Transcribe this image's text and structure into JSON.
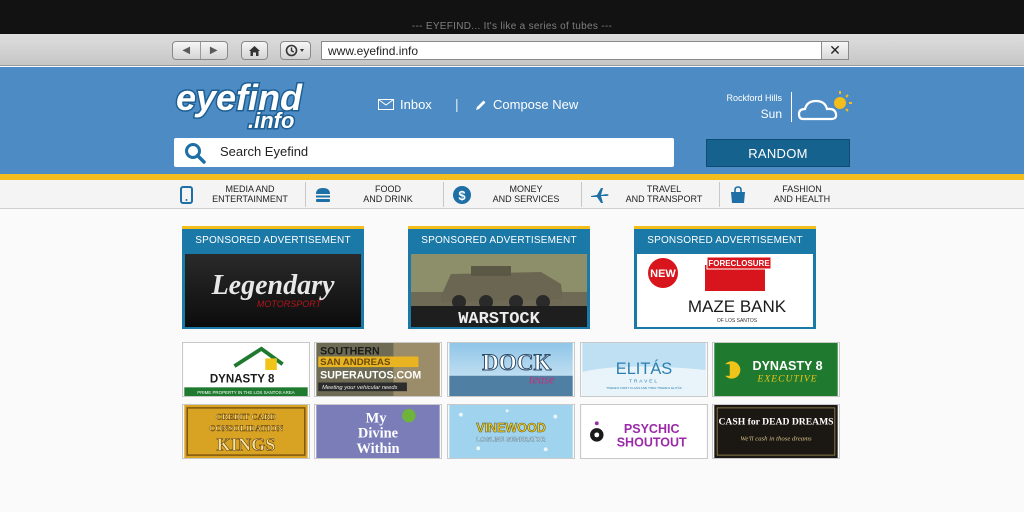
{
  "window": {
    "title": "--- EYEFIND... It's like a series of tubes ---"
  },
  "browser": {
    "url": "www.eyefind.info",
    "close_glyph": "✕",
    "back_glyph": "◀",
    "forward_glyph": "▶"
  },
  "header": {
    "logo_top": "eyefind",
    "logo_bottom": ".info",
    "inbox_label": "Inbox",
    "separator": "|",
    "compose_label": "Compose New",
    "weather": {
      "location": "Rockford Hills",
      "day": "Sun",
      "icon": "cloud-sun-icon"
    }
  },
  "search": {
    "placeholder": "Search Eyefind",
    "random_label": "RANDOM"
  },
  "categories": [
    {
      "line1": "MEDIA AND",
      "line2": "ENTERTAINMENT",
      "icon": "tablet-icon"
    },
    {
      "line1": "FOOD",
      "line2": "AND DRINK",
      "icon": "burger-icon"
    },
    {
      "line1": "MONEY",
      "line2": "AND SERVICES",
      "icon": "dollar-icon"
    },
    {
      "line1": "TRAVEL",
      "line2": "AND TRANSPORT",
      "icon": "plane-icon"
    },
    {
      "line1": "FASHION",
      "line2": "AND HEALTH",
      "icon": "bag-icon"
    }
  ],
  "sponsored": [
    {
      "header": "SPONSORED ADVERTISEMENT",
      "title": "Legendary",
      "subtitle": "MOTORSPORT"
    },
    {
      "header": "SPONSORED ADVERTISEMENT",
      "title": "WARSTOCK"
    },
    {
      "header": "SPONSORED ADVERTISEMENT",
      "badge": "NEW",
      "banner": "FORECLOSURE",
      "title": "MAZE BANK",
      "subtitle": "OF LOS SANTOS"
    }
  ],
  "tiles": [
    {
      "line1": "DYNASTY 8",
      "line2": "PRIME PROPERTY IN THE LOS SANTOS AREA"
    },
    {
      "line1": "SOUTHERN",
      "line2": "SAN ANDREAS",
      "line3": "SUPERAUTOS.COM",
      "line4": "Meeting your vehicular needs"
    },
    {
      "line1": "DOCK",
      "line2": "tease"
    },
    {
      "line1": "ELITÁS",
      "line2": "TRAVEL",
      "line3": "THERE'S FIRST CLASS AND THEN THERE'S ELITÁS"
    },
    {
      "line1": "DYNASTY 8",
      "line2": "EXECUTIVE"
    },
    {
      "line1": "CREDIT CARD",
      "line2": "CONSOLIDATION",
      "line3": "KINGS"
    },
    {
      "line1": "My",
      "line2": "Divine",
      "line3": "Within"
    },
    {
      "line1": "VINEWOOD",
      "line2": "LOGLINE GENERATOR"
    },
    {
      "line1": "PSYCHIC",
      "line2": "SHOUTOUT"
    },
    {
      "line1": "CASH for DEAD DREAMS",
      "line2": "We'll cash in those dreams"
    }
  ]
}
